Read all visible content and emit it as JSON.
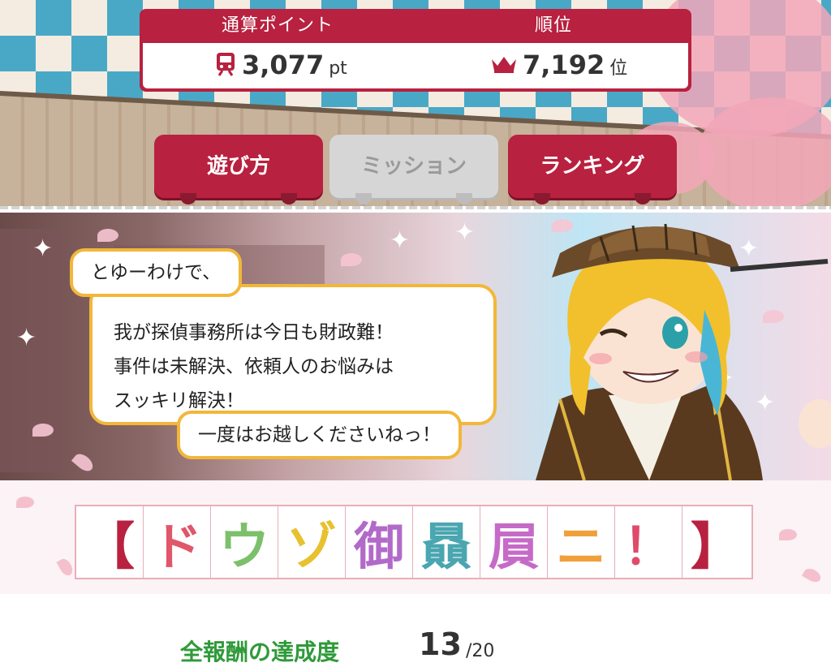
{
  "header": {
    "points_label": "通算ポイント",
    "rank_label": "順位",
    "points_value": "3,077",
    "points_unit": "pt",
    "rank_value": "7,192",
    "rank_unit": "位",
    "points_icon": "train-icon",
    "rank_icon": "crown-icon"
  },
  "tabs": [
    {
      "label": "遊び方",
      "state": "active"
    },
    {
      "label": "ミッション",
      "state": "disabled"
    },
    {
      "label": "ランキング",
      "state": "active"
    }
  ],
  "dialogue": {
    "line1": "とゆーわけで、",
    "body": [
      "我が探偵事務所は今日も財政難！",
      "事件は未解決、依頼人のお悩みは",
      "スッキリ解決！"
    ],
    "line2": "一度はお越しくださいねっ！"
  },
  "title_banner": {
    "chars": [
      "【",
      "ド",
      "ウ",
      "ゾ",
      "御",
      "贔",
      "屓",
      "ニ",
      "！",
      "】"
    ],
    "colors": [
      "#b8213f",
      "#e0566a",
      "#7cc06a",
      "#e8c12f",
      "#b26ac9",
      "#4aa6b0",
      "#c66ac8",
      "#f0a03a",
      "#e04a6a",
      "#b8213f"
    ]
  },
  "rewards": {
    "label": "全報酬の達成度",
    "current": "13",
    "max": "/20"
  },
  "colors": {
    "accent": "#b8213f",
    "reward_green": "#2f9a3a",
    "bubble_border": "#f2b73a"
  }
}
